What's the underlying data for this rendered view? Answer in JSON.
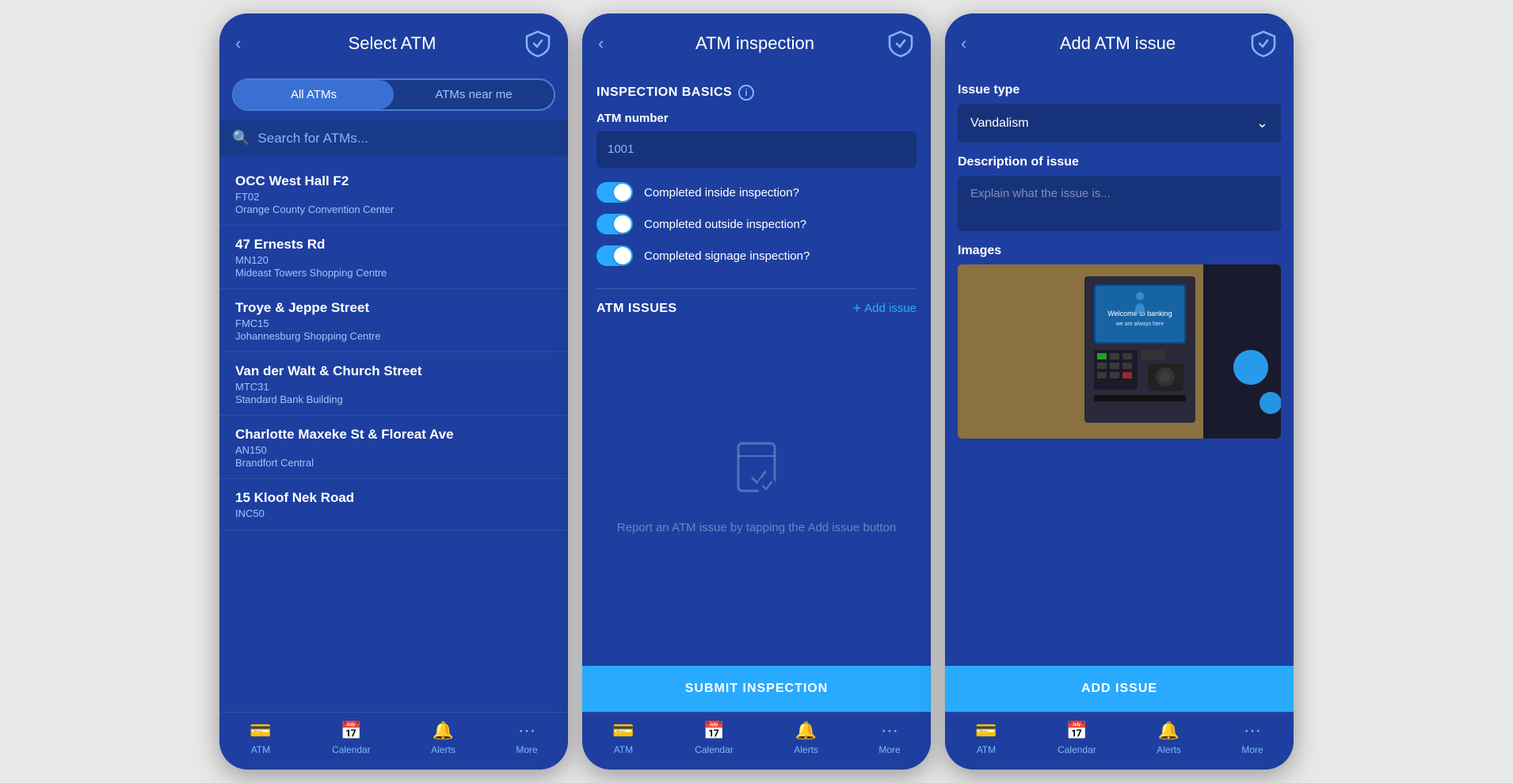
{
  "screens": [
    {
      "id": "select-atm",
      "header": {
        "title": "Select ATM",
        "back_visible": true
      },
      "tabs": [
        {
          "label": "All ATMs",
          "active": true
        },
        {
          "label": "ATMs near me",
          "active": false
        }
      ],
      "search_placeholder": "Search for ATMs...",
      "atm_list": [
        {
          "name": "OCC West Hall F2",
          "code": "FT02",
          "location": "Orange County Convention Center"
        },
        {
          "name": "47 Ernests Rd",
          "code": "MN120",
          "location": "Mideast Towers Shopping Centre"
        },
        {
          "name": "Troye & Jeppe Street",
          "code": "FMC15",
          "location": "Johannesburg Shopping Centre"
        },
        {
          "name": "Van der Walt & Church Street",
          "code": "MTC31",
          "location": "Standard Bank Building"
        },
        {
          "name": "Charlotte Maxeke St & Floreat Ave",
          "code": "AN150",
          "location": "Brandfort Central"
        },
        {
          "name": "15 Kloof Nek Road",
          "code": "INC50",
          "location": ""
        }
      ],
      "nav": [
        {
          "icon": "atm",
          "label": "ATM"
        },
        {
          "icon": "calendar",
          "label": "Calendar"
        },
        {
          "icon": "bell",
          "label": "Alerts"
        },
        {
          "icon": "more",
          "label": "More"
        }
      ]
    },
    {
      "id": "atm-inspection",
      "header": {
        "title": "ATM inspection",
        "back_visible": true
      },
      "section_basics": "INSPECTION BASICS",
      "atm_number_label": "ATM number",
      "atm_number_value": "1001",
      "toggles": [
        {
          "label": "Completed inside inspection?",
          "on": true
        },
        {
          "label": "Completed outside inspection?",
          "on": true
        },
        {
          "label": "Completed signage inspection?",
          "on": true
        }
      ],
      "section_issues": "ATM ISSUES",
      "add_issue_label": "Add issue",
      "empty_state_text": "Report an ATM issue by\ntapping the Add issue button",
      "submit_btn_label": "SUBMIT INSPECTION",
      "nav": [
        {
          "icon": "atm",
          "label": "ATM"
        },
        {
          "icon": "calendar",
          "label": "Calendar"
        },
        {
          "icon": "bell",
          "label": "Alerts"
        },
        {
          "icon": "more",
          "label": "More"
        }
      ]
    },
    {
      "id": "add-atm-issue",
      "header": {
        "title": "Add ATM issue",
        "back_visible": true
      },
      "issue_type_label": "Issue type",
      "issue_type_value": "Vandalism",
      "desc_label": "Description of issue",
      "desc_placeholder": "Explain what the issue is...",
      "images_label": "Images",
      "add_btn_label": "ADD ISSUE",
      "nav": [
        {
          "icon": "atm",
          "label": "ATM"
        },
        {
          "icon": "calendar",
          "label": "Calendar"
        },
        {
          "icon": "bell",
          "label": "Alerts"
        },
        {
          "icon": "more",
          "label": "More"
        }
      ]
    }
  ]
}
